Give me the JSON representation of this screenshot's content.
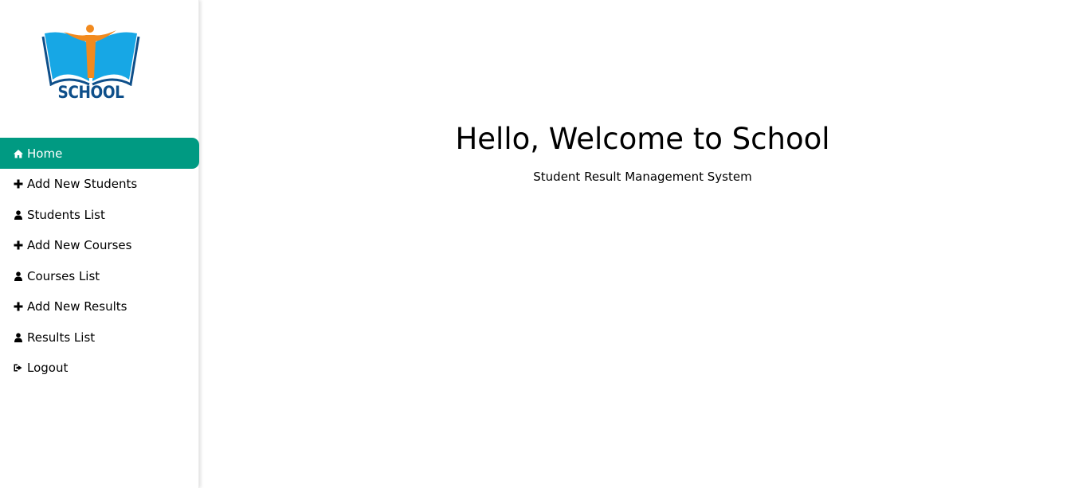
{
  "logo": {
    "text": "SCHOOL",
    "colors": {
      "book": "#17a7e5",
      "book_edge": "#0e4f8a",
      "figure": "#f28a1e"
    }
  },
  "sidebar": {
    "items": [
      {
        "label": "Home",
        "icon": "home-icon",
        "active": true
      },
      {
        "label": "Add New Students",
        "icon": "plus-icon",
        "active": false
      },
      {
        "label": "Students List",
        "icon": "user-icon",
        "active": false
      },
      {
        "label": "Add New Courses",
        "icon": "plus-icon",
        "active": false
      },
      {
        "label": "Courses List",
        "icon": "user-icon",
        "active": false
      },
      {
        "label": "Add New Results",
        "icon": "plus-icon",
        "active": false
      },
      {
        "label": "Results List",
        "icon": "user-icon",
        "active": false
      },
      {
        "label": "Logout",
        "icon": "sign-out-icon",
        "active": false
      }
    ],
    "active_color": "#009a82"
  },
  "main": {
    "title": "Hello, Welcome to School",
    "subtitle": "Student Result Management System"
  }
}
